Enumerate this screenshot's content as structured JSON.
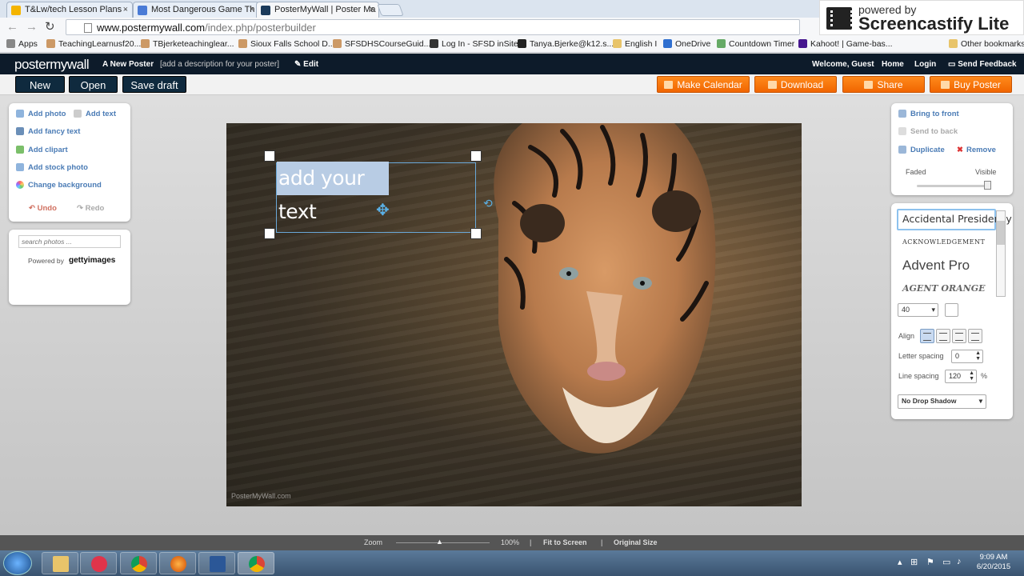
{
  "browser": {
    "tabs": [
      {
        "title": "T&Lw/tech Lesson Plans -"
      },
      {
        "title": "Most Dangerous Game Th"
      },
      {
        "title": "PosterMyWall | Poster Ma"
      }
    ],
    "url_host": "www.postermywall.com",
    "url_path": "/index.php/posterbuilder",
    "bookmarks": [
      "Apps",
      "TeachingLearnusf20...",
      "TBjerketeachinglear...",
      "Sioux Falls School D...",
      "SFSDHSCourseGuid...",
      "Log In - SFSD inSite",
      "Tanya.Bjerke@k12.s...",
      "English I",
      "OneDrive",
      "Countdown Timer",
      "Kahoot! | Game-bas..."
    ],
    "other_bookmarks": "Other bookmarks"
  },
  "screencastify": {
    "line1": "powered by",
    "line2": "Screencastify Lite"
  },
  "header": {
    "logo": "postermywall",
    "poster_name": "A New Poster",
    "description": "[add a description for your poster]",
    "edit": "Edit",
    "welcome": "Welcome, Guest",
    "home": "Home",
    "login": "Login",
    "feedback": "Send Feedback"
  },
  "actions": {
    "new": "New",
    "open": "Open",
    "save_draft": "Save draft",
    "make_calendar": "Make Calendar",
    "download": "Download",
    "share": "Share",
    "buy_poster": "Buy Poster"
  },
  "left_panel": {
    "add_photo": "Add photo",
    "add_text": "Add text",
    "add_fancy_text": "Add fancy text",
    "add_clipart": "Add clipart",
    "add_stock_photo": "Add stock photo",
    "change_background": "Change background",
    "undo": "Undo",
    "redo": "Redo"
  },
  "search": {
    "placeholder": "search photos ...",
    "powered_by": "Powered by",
    "brand": "gettyimages"
  },
  "canvas": {
    "text": "add your text",
    "watermark": "PosterMyWall.com"
  },
  "right_panel": {
    "bring_front": "Bring to front",
    "send_back": "Send to back",
    "duplicate": "Duplicate",
    "remove": "Remove",
    "faded": "Faded",
    "visible": "Visible"
  },
  "fonts": {
    "list": [
      "Accidental Presidency",
      "ACKNOWLEDGEMENT",
      "Advent Pro",
      "AGENT ORANGE"
    ],
    "size": "40",
    "align_label": "Align",
    "letter_spacing_label": "Letter spacing",
    "letter_spacing": "0",
    "line_spacing_label": "Line spacing",
    "line_spacing": "120",
    "percent": "%",
    "shadow": "No Drop Shadow"
  },
  "zoom": {
    "label": "Zoom",
    "value": "100%",
    "fit": "Fit to Screen",
    "original": "Original Size"
  },
  "taskbar": {
    "time": "9:09 AM",
    "date": "6/20/2015"
  }
}
